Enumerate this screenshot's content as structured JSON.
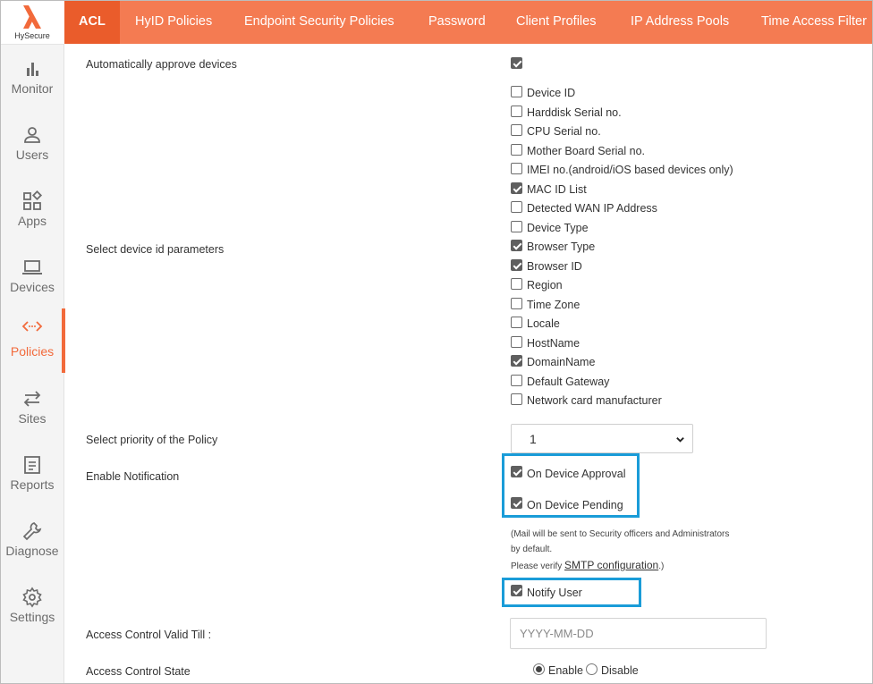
{
  "brand": {
    "name": "HySecure",
    "accent": "#f26a3b",
    "highlight": "#1a9cd8"
  },
  "sidebar": {
    "items": [
      {
        "label": "Monitor",
        "icon": "bar-chart-icon"
      },
      {
        "label": "Users",
        "icon": "user-icon"
      },
      {
        "label": "Apps",
        "icon": "apps-grid-icon"
      },
      {
        "label": "Devices",
        "icon": "laptop-icon"
      },
      {
        "label": "Policies",
        "icon": "code-arrows-icon",
        "active": true
      },
      {
        "label": "Sites",
        "icon": "swap-arrows-icon"
      },
      {
        "label": "Reports",
        "icon": "report-icon"
      },
      {
        "label": "Diagnose",
        "icon": "wrench-icon"
      },
      {
        "label": "Settings",
        "icon": "gear-icon"
      }
    ]
  },
  "tabs": [
    {
      "label": "ACL",
      "active": true
    },
    {
      "label": "HyID Policies"
    },
    {
      "label": "Endpoint Security Policies"
    },
    {
      "label": "Password"
    },
    {
      "label": "Client Profiles"
    },
    {
      "label": "IP Address Pools"
    },
    {
      "label": "Time Access Filter"
    }
  ],
  "form": {
    "auto_approve": {
      "label": "Automatically approve devices",
      "checked": true
    },
    "device_id_params": {
      "label": "Select device id parameters",
      "options": [
        {
          "label": "Device ID",
          "checked": false
        },
        {
          "label": "Harddisk Serial no.",
          "checked": false
        },
        {
          "label": "CPU Serial no.",
          "checked": false
        },
        {
          "label": "Mother Board Serial no.",
          "checked": false
        },
        {
          "label": "IMEI no.(android/iOS based devices only)",
          "checked": false
        },
        {
          "label": "MAC ID List",
          "checked": true
        },
        {
          "label": "Detected WAN IP Address",
          "checked": false
        },
        {
          "label": "Device Type",
          "checked": false
        },
        {
          "label": "Browser Type",
          "checked": true
        },
        {
          "label": "Browser ID",
          "checked": true
        },
        {
          "label": "Region",
          "checked": false
        },
        {
          "label": "Time Zone",
          "checked": false
        },
        {
          "label": "Locale",
          "checked": false
        },
        {
          "label": "HostName",
          "checked": false
        },
        {
          "label": "DomainName",
          "checked": true
        },
        {
          "label": "Default Gateway",
          "checked": false
        },
        {
          "label": "Network card manufacturer",
          "checked": false
        }
      ]
    },
    "priority": {
      "label": "Select priority of the Policy",
      "value": "1"
    },
    "notification": {
      "label": "Enable Notification",
      "on_approval": {
        "label": "On Device Approval",
        "checked": true
      },
      "on_pending": {
        "label": "On Device Pending",
        "checked": true
      },
      "note_line1": "(Mail will be sent to Security officers and Administrators",
      "note_line2": "by default.",
      "note_line3_prefix": "Please verify ",
      "note_link": "SMTP configuration",
      "note_line3_suffix": ".)",
      "notify_user": {
        "label": "Notify User",
        "checked": true
      }
    },
    "valid_till": {
      "label": "Access Control Valid Till :",
      "placeholder": "YYYY-MM-DD",
      "value": ""
    },
    "state": {
      "label": "Access Control State",
      "enable_label": "Enable",
      "disable_label": "Disable",
      "selected": "Enable"
    }
  }
}
